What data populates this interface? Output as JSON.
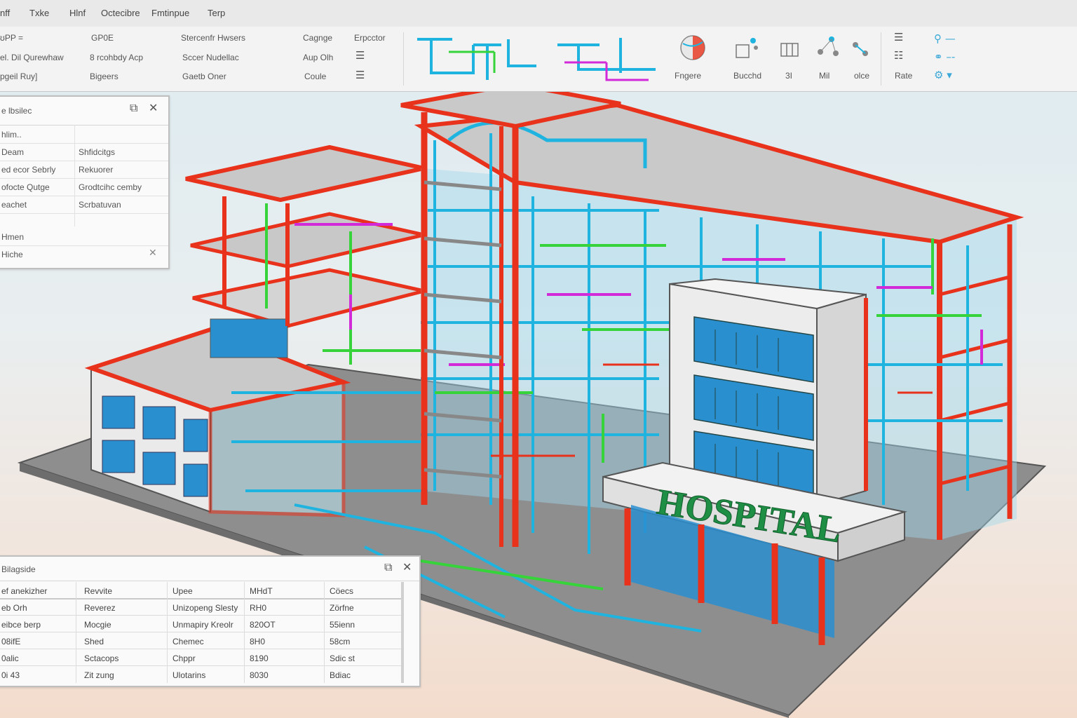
{
  "menu": [
    "nff",
    "Txke",
    "Hlnf",
    "Octecibre",
    "Fmtinpue",
    "Terp"
  ],
  "ribbon": {
    "col1": [
      "ʊPP =",
      "el. Dil Qurewhaw",
      "pgeil Ruy]"
    ],
    "col2": [
      "GP0E",
      "8 rcohbdy Acp",
      "Bigeers"
    ],
    "col3": [
      "Stercenfr Hwsers",
      "Sccer Nudellac",
      "Gaetb Oner"
    ],
    "col4a": [
      "Cagnge",
      "Aup Olh",
      "Coule"
    ],
    "col4b": [
      "Erpcctor"
    ],
    "tools": [
      "Fngere",
      "Bucchd",
      "3I",
      "Mil",
      "olce"
    ],
    "rate": "Rate"
  },
  "properties_panel": {
    "title": "e lbsilec",
    "rows": [
      {
        "k": "hlim..",
        "v": ""
      },
      {
        "k": "Deam",
        "v": "Shfidcitgs"
      },
      {
        "k": "ed ecor Sebrly",
        "v": "Rekuorer"
      },
      {
        "k": "ofocte Qutge",
        "v": "Grodtcihc cemby"
      },
      {
        "k": "eachet",
        "v": "Scrbatuvan"
      },
      {
        "k": "",
        "v": ""
      },
      {
        "k": "Hmen",
        "v": ""
      },
      {
        "k": "Hiche",
        "v": ""
      }
    ]
  },
  "schedule_panel": {
    "title": "Bilagside",
    "headers": [
      "ef anekizher",
      "Revvite",
      "Upee",
      "MHdT",
      "Cöecs"
    ],
    "rows": [
      [
        "eb Orh",
        "Reverez",
        "Unizopeng Slesty",
        "RH0",
        "Zörfne"
      ],
      [
        "eibce berp",
        "Mocgie",
        "Unmapiry Kreolr",
        "820OT",
        "55ienn"
      ],
      [
        "08ifE",
        "Shed",
        "Chemec",
        "8H0",
        "58cm"
      ],
      [
        "0alic",
        "Sctacops",
        "Chppr",
        "8190",
        "Sdic st"
      ],
      [
        "0i 43",
        "Zit zung",
        "Ulotarins",
        "8030",
        "Bdiac"
      ]
    ]
  },
  "model": {
    "sign": "HOSPITAL"
  },
  "colors": {
    "structure": "#e8321c",
    "duct_blue": "#1fb4e0",
    "pipe_green": "#36d43a",
    "pipe_magenta": "#d22ad8",
    "sign_green": "#1f8f45",
    "glass": "#2a8fcf"
  },
  "icons": [
    "minimize-icon",
    "close-icon",
    "globe-icon",
    "layers-icon",
    "network-icon",
    "settings-icon"
  ]
}
